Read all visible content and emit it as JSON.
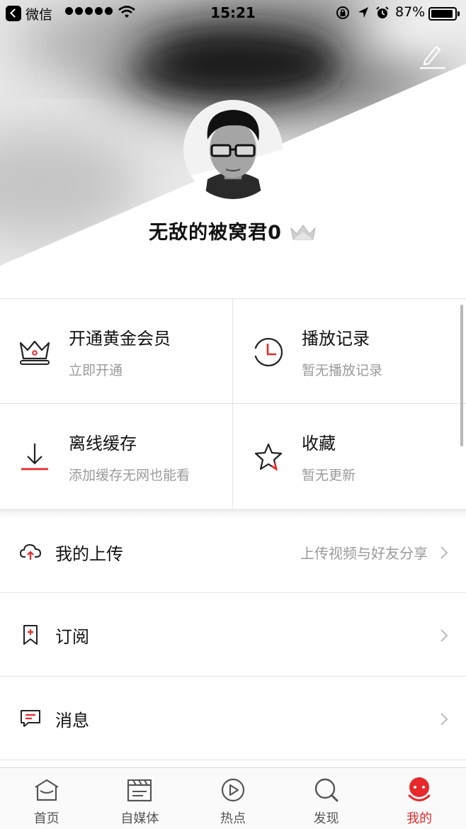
{
  "status_bar": {
    "back_app": "微信",
    "time": "15:21",
    "battery": "87%"
  },
  "profile": {
    "username": "无敌的被窝君0"
  },
  "grid": [
    {
      "title": "开通黄金会员",
      "subtitle": "立即开通",
      "icon": "crown-icon"
    },
    {
      "title": "播放记录",
      "subtitle": "暂无播放记录",
      "icon": "clock-icon"
    },
    {
      "title": "离线缓存",
      "subtitle": "添加缓存无网也能看",
      "icon": "download-icon"
    },
    {
      "title": "收藏",
      "subtitle": "暂无更新",
      "icon": "star-icon"
    }
  ],
  "list": [
    {
      "label": "我的上传",
      "hint": "上传视频与好友分享",
      "icon": "cloud-upload-icon"
    },
    {
      "label": "订阅",
      "hint": "",
      "icon": "bookmark-icon"
    },
    {
      "label": "消息",
      "hint": "",
      "icon": "message-icon"
    }
  ],
  "tabs": [
    {
      "label": "首页",
      "icon": "home-icon"
    },
    {
      "label": "自媒体",
      "icon": "clapperboard-icon"
    },
    {
      "label": "热点",
      "icon": "play-circle-icon"
    },
    {
      "label": "发现",
      "icon": "search-icon"
    },
    {
      "label": "我的",
      "icon": "mascot-icon",
      "active": true
    }
  ],
  "colors": {
    "accent": "#e8282a",
    "text": "#111111",
    "secondary": "#9a9a9a"
  }
}
